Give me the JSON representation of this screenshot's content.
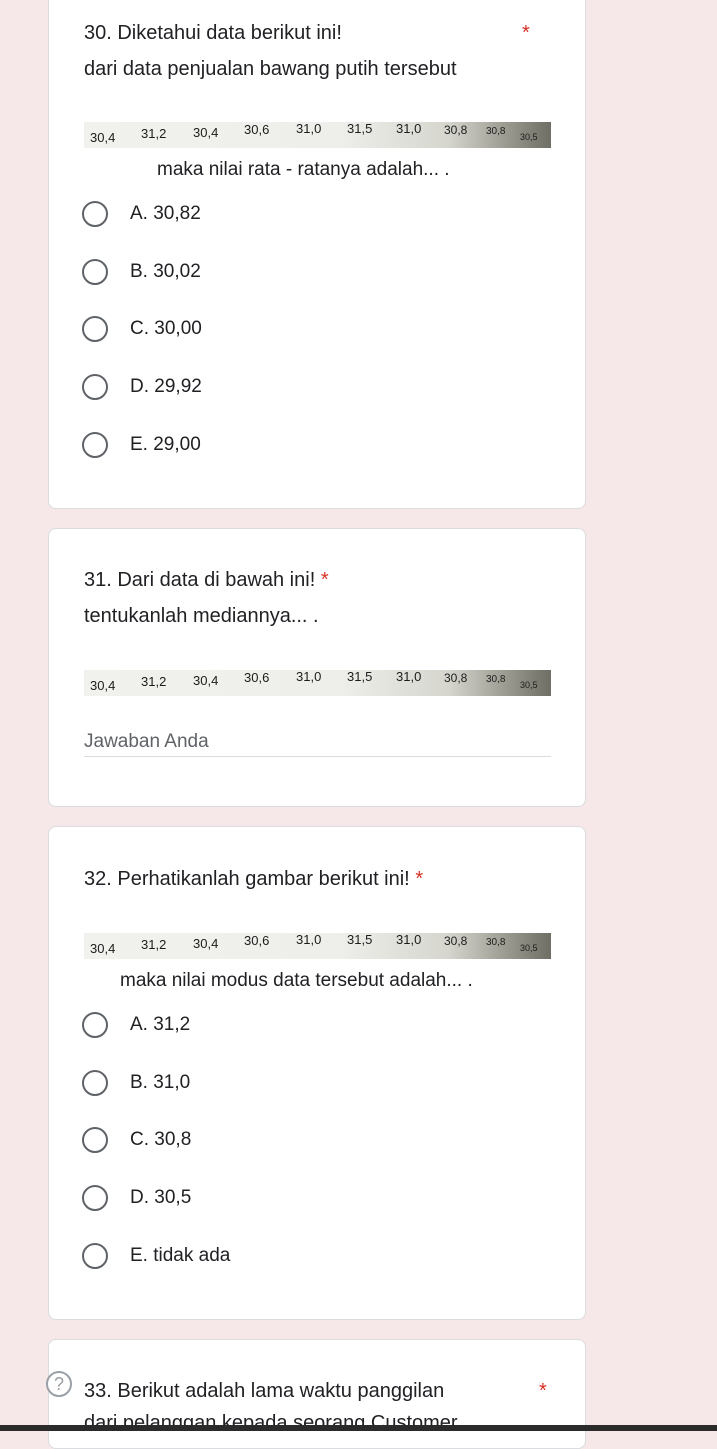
{
  "q30": {
    "title": "30. Diketahui data berikut ini!",
    "required_mark": "*",
    "subtitle": "dari data penjualan bawang putih tersebut",
    "data_values": [
      "30,4",
      "31,2",
      "30,4",
      "30,6",
      "31,0",
      "31,5",
      "31,0",
      "30,8",
      "30,8",
      "30,5"
    ],
    "caption": "maka nilai rata - ratanya adalah... .",
    "options": [
      "A. 30,82",
      "B. 30,02",
      "C. 30,00",
      "D. 29,92",
      "E. 29,00"
    ]
  },
  "q31": {
    "title": "31. Dari data di bawah ini!",
    "required_mark": "*",
    "subtitle": "tentukanlah mediannya... .",
    "data_values": [
      "30,4",
      "31,2",
      "30,4",
      "30,6",
      "31,0",
      "31,5",
      "31,0",
      "30,8",
      "30,8",
      "30,5"
    ],
    "answer_placeholder": "Jawaban Anda"
  },
  "q32": {
    "title": "32. Perhatikanlah gambar berikut ini!",
    "required_mark": "*",
    "data_values": [
      "30,4",
      "31,2",
      "30,4",
      "30,6",
      "31,0",
      "31,5",
      "31,0",
      "30,8",
      "30,8",
      "30,5"
    ],
    "caption": "maka nilai modus data tersebut adalah... .",
    "options": [
      "A. 31,2",
      "B. 31,0",
      "C. 30,8",
      "D. 30,5",
      "E. tidak ada"
    ]
  },
  "q33": {
    "title": "33. Berikut adalah lama waktu panggilan",
    "required_mark": "*",
    "subtitle_partial": "dari pelanggan kepada seorang Customer"
  },
  "help": {
    "icon": "help-circle-icon",
    "glyph": "?"
  },
  "colors": {
    "background": "#f6e8e8",
    "card": "#ffffff",
    "required": "#d93025",
    "radio_border": "#5f6368"
  }
}
